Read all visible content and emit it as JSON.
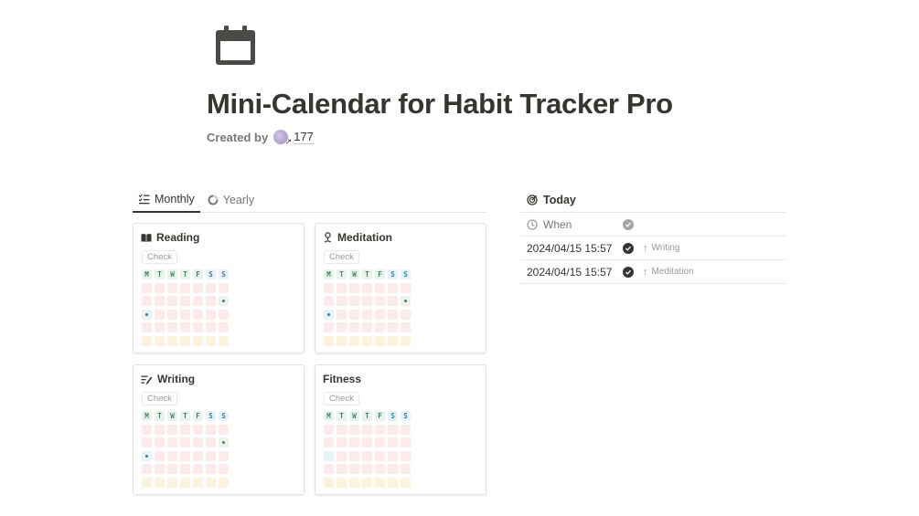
{
  "page": {
    "icon": "calendar-icon",
    "title": "Mini-Calendar for Habit Tracker Pro",
    "created_label": "Created by",
    "creator_count": "177"
  },
  "tabs": [
    {
      "label": "Monthly",
      "icon": "checklist-icon",
      "active": true
    },
    {
      "label": "Yearly",
      "icon": "pie-icon",
      "active": false
    }
  ],
  "weekday_headers": [
    "M",
    "T",
    "W",
    "T",
    "F",
    "S",
    "S"
  ],
  "habits": [
    {
      "name": "Reading",
      "icon": "book-icon",
      "check_label": "Check",
      "done": [
        [
          1,
          6
        ]
      ],
      "today": [
        [
          2,
          0
        ]
      ]
    },
    {
      "name": "Meditation",
      "icon": "meditation-icon",
      "check_label": "Check",
      "done": [
        [
          1,
          6
        ]
      ],
      "today": [
        [
          2,
          0
        ]
      ]
    },
    {
      "name": "Writing",
      "icon": "writing-icon",
      "check_label": "Check",
      "done": [
        [
          1,
          6
        ]
      ],
      "today": [
        [
          2,
          0
        ]
      ]
    },
    {
      "name": "Fitness",
      "icon": "",
      "check_label": "Check",
      "done": [],
      "today": [
        [
          2,
          0
        ]
      ]
    }
  ],
  "today": {
    "title": "Today",
    "icon": "target-icon",
    "column_label": "When",
    "rows": [
      {
        "when": "2024/04/15 15:57",
        "habit": "Writing"
      },
      {
        "when": "2024/04/15 15:57",
        "habit": "Meditation"
      }
    ]
  },
  "colors": {
    "text": "#37352f",
    "muted": "#787774",
    "cell_pink": "#fdebec",
    "cell_yellow": "#fbf3db",
    "cell_green": "#edf3ec",
    "cell_blue": "#e7f3f8",
    "header_green": "#448361",
    "header_blue": "#337ea9"
  }
}
